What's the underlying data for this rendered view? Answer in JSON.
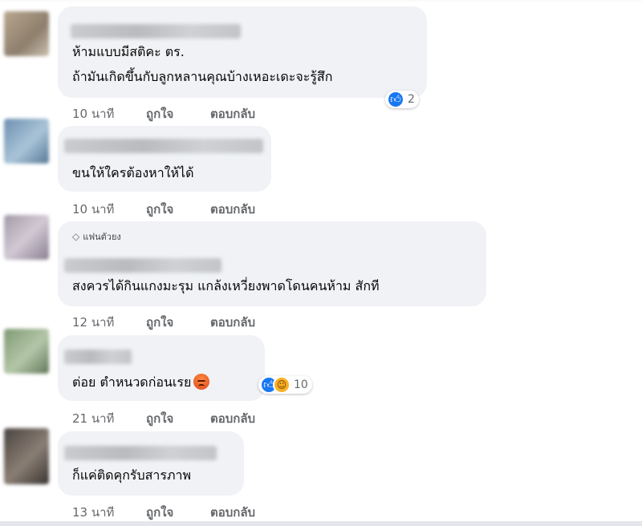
{
  "comments": [
    {
      "lines": [
        "ห้ามแบบมีสติคะ ตร.",
        "ถ้ามันเกิดขึ้นกับลูกหลานคุณบ้างเหอะเดะจะรู้สึก"
      ],
      "time": "10 นาที",
      "like": "ถูกใจ",
      "reply": "ตอบกลับ",
      "reactions": {
        "icons": [
          "like-icon"
        ],
        "count": "2"
      }
    },
    {
      "lines": [
        "ขนให้ใครต้องหาให้ได้"
      ],
      "time": "10 นาที",
      "like": "ถูกใจ",
      "reply": "ตอบกลับ"
    },
    {
      "badge": "แฟนตัวยง",
      "lines": [
        "สงควรได้กินแกงมะรุม แกล้งเหวี่ยงพาดโดนคนห้าม สักที"
      ],
      "time": "12 นาที",
      "like": "ถูกใจ",
      "reply": "ตอบกลับ"
    },
    {
      "lines": [
        "ต่อย ตำหนวดก่อนเรย"
      ],
      "time": "21 นาที",
      "like": "ถูกใจ",
      "reply": "ตอบกลับ",
      "reactions": {
        "icons": [
          "like-icon",
          "haha-icon"
        ],
        "count": "10"
      }
    },
    {
      "lines": [
        "ก็แค่ติดคุกรับสารภาพ"
      ],
      "time": "13 นาที",
      "like": "ถูกใจ",
      "reply": "ตอบกลับ"
    }
  ],
  "colors": {
    "bubble": "#f0f2f5",
    "meta_text": "#65676b",
    "like_blue": "#1877f2"
  }
}
